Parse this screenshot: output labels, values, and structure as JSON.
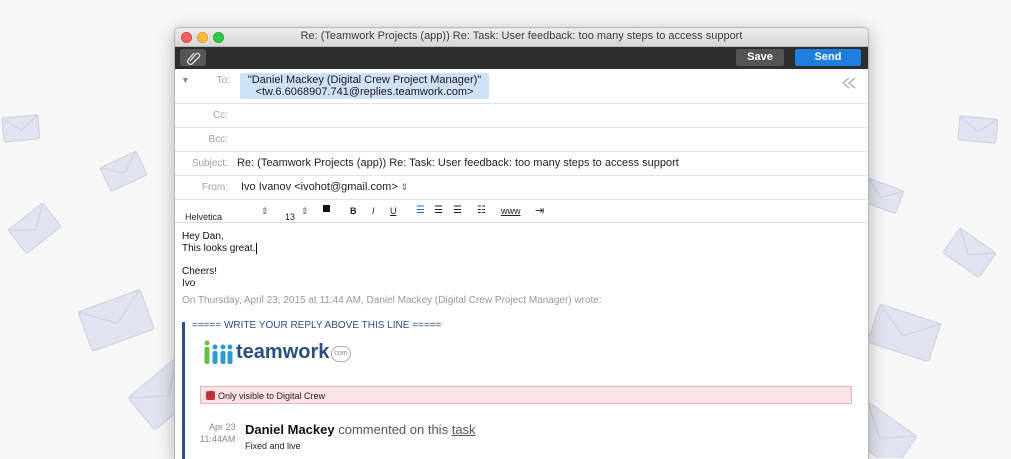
{
  "window": {
    "title": "Re: (Teamwork Projects (app)) Re: Task: User feedback: too many steps to access support"
  },
  "toolbar": {
    "save_label": "Save",
    "send_label": "Send"
  },
  "header": {
    "to_label": "To:",
    "to_name": "\"Daniel Mackey (Digital Crew Project Manager)\"",
    "to_address": "<tw.6.6068907.741@replies.teamwork.com>",
    "cc_label": "Cc:",
    "bcc_label": "Bcc:",
    "subject_label": "Subject:",
    "subject_value": "Re: (Teamwork Projects (app)) Re: Task: User feedback: too many steps to access support",
    "from_label": "From:",
    "from_value": "Ivo Ivanov <ivohot@gmail.com>"
  },
  "format_bar": {
    "font": "Helvetica",
    "size": "13",
    "bold": "B",
    "italic": "I",
    "underline": "U",
    "link": "www"
  },
  "message": {
    "line1": "Hey Dan,",
    "line2": "This looks great.",
    "line3": "Cheers!",
    "line4": "Ivo"
  },
  "quoted": {
    "attribution": "On Thursday, April 23, 2015 at 11:44 AM, Daniel Mackey (Digital Crew Project Manager) wrote:",
    "reply_marker": "===== WRITE YOUR REPLY ABOVE THIS LINE =====",
    "logo_text": "teamwork",
    "logo_badge": "com",
    "notice": "Only visible to Digital Crew",
    "date": "Apr 23",
    "time": "11:44AM",
    "author": "Daniel Mackey",
    "action": "commented on this",
    "link": "task",
    "comment": "Fixed and live"
  },
  "colors": {
    "send": "#1e7fe0",
    "accent_blue": "#2d4e8a",
    "to_pill": "#cfe1f6"
  }
}
